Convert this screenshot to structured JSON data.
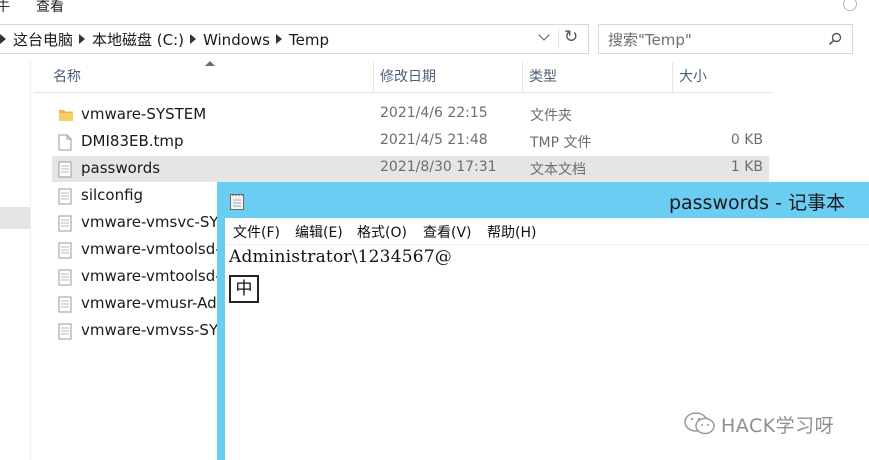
{
  "ribbon": {
    "tab_partial": "牛",
    "tab_view": "查看"
  },
  "address": {
    "crumbs": [
      "这台电脑",
      "本地磁盘 (C:)",
      "Windows",
      "Temp"
    ]
  },
  "search": {
    "placeholder": "搜索\"Temp\""
  },
  "columns": {
    "name": "名称",
    "modified": "修改日期",
    "type": "类型",
    "size": "大小"
  },
  "files": [
    {
      "name": "vmware-SYSTEM",
      "modified": "2021/4/6 22:15",
      "type": "文件夹",
      "size": "",
      "icon": "folder-icon",
      "selected": false
    },
    {
      "name": "DMI83EB.tmp",
      "modified": "2021/4/5 21:48",
      "type": "TMP 文件",
      "size": "0 KB",
      "icon": "file-icon",
      "selected": false
    },
    {
      "name": "passwords",
      "modified": "2021/8/30 17:31",
      "type": "文本文档",
      "size": "1 KB",
      "icon": "text-file-icon",
      "selected": true
    },
    {
      "name": "silconfig",
      "modified": "",
      "type": "",
      "size": "",
      "icon": "text-file-icon",
      "selected": false
    },
    {
      "name": "vmware-vmsvc-SYS",
      "modified": "",
      "type": "",
      "size": "",
      "icon": "text-file-icon",
      "selected": false
    },
    {
      "name": "vmware-vmtoolsd-",
      "modified": "",
      "type": "",
      "size": "",
      "icon": "text-file-icon",
      "selected": false
    },
    {
      "name": "vmware-vmtoolsd-",
      "modified": "",
      "type": "",
      "size": "",
      "icon": "text-file-icon",
      "selected": false
    },
    {
      "name": "vmware-vmusr-Adr",
      "modified": "",
      "type": "",
      "size": "",
      "icon": "text-file-icon",
      "selected": false
    },
    {
      "name": "vmware-vmvss-SYS",
      "modified": "",
      "type": "",
      "size": "",
      "icon": "text-file-icon",
      "selected": false
    }
  ],
  "notepad": {
    "title": "passwords - 记事本",
    "menu": [
      "文件(F)",
      "编辑(E)",
      "格式(O)",
      "查看(V)",
      "帮助(H)"
    ],
    "content": "Administrator\\1234567@",
    "ime_indicator": "中",
    "titlebar_color": "#6ccdf2"
  },
  "watermark": {
    "text": "HACK学习呀"
  },
  "colors": {
    "selected_row": "#e5e5e5",
    "header_text": "#4c607a"
  }
}
